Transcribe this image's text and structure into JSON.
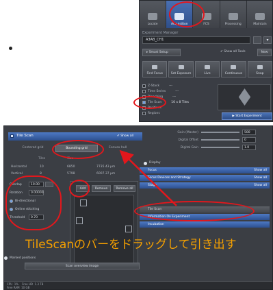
{
  "top_panel": {
    "tabs": [
      {
        "label": "Locate",
        "icon": "eye-icon"
      },
      {
        "label": "Acquisition",
        "icon": "camera-icon"
      },
      {
        "label": "FCS",
        "icon": "fcs-icon"
      },
      {
        "label": "Processing",
        "icon": "processing-icon"
      },
      {
        "label": "Maintain",
        "icon": "maintain-icon"
      }
    ],
    "experiment_label": "Experiment Manager",
    "experiment_value": "A3AB_CH1",
    "smart_setup": "Smart Setup",
    "show_all_tools": "Show all Tools",
    "new_label": "New",
    "acq_buttons": [
      "Find Focus",
      "Set Exposure",
      "Live",
      "Continuous",
      "Snap"
    ],
    "dims": [
      {
        "label": "Z-Stack",
        "checked": false,
        "value": "---"
      },
      {
        "label": "Time Series",
        "checked": false,
        "value": "---"
      },
      {
        "label": "Bleaching",
        "checked": false,
        "value": "---"
      },
      {
        "label": "Tile Scan",
        "checked": true,
        "value": "10 x 8 Tiles"
      },
      {
        "label": "Positions",
        "checked": false,
        "value": ""
      },
      {
        "label": "Regions",
        "checked": false,
        "value": ""
      }
    ],
    "start_experiment": "Start Experiment"
  },
  "bottom_panel": {
    "tile_scan_title": "Tile Scan",
    "view_all": "Show all",
    "modes": [
      "Centered grid",
      "Bounding grid",
      "Convex hull"
    ],
    "grid_headers": [
      "Tiles",
      "Size"
    ],
    "grid_rows": [
      {
        "label": "Horizontal",
        "tiles": "10",
        "size": "6850",
        "extra": "7735.43 µm"
      },
      {
        "label": "Vertical",
        "tiles": "8",
        "size": "5798",
        "extra": "6007.37 µm"
      }
    ],
    "overlap_label": "Overlap",
    "overlap_value": "10.00",
    "rotation_label": "Rotation",
    "rotation_value": "0.00000",
    "bidirectional": "Bi-directional",
    "online_stitching": "Online stitching",
    "threshold_label": "Threshold",
    "threshold_value": "0.70",
    "region_buttons": [
      "Add",
      "Remove",
      "Remove all"
    ],
    "marked_positions": "Marked positions",
    "scan_overview": "Scan overview image",
    "status": {
      "cpu": "CPU",
      "cpu_val": "1%",
      "free_hd": "Free HD",
      "free_hd_val": "1.3 TB",
      "free_ram": "Free RAM",
      "free_ram_val": "10 GB"
    },
    "right_col": {
      "gain_rows": [
        {
          "label": "Gain (Master)",
          "value": "500"
        },
        {
          "label": "Digital Offset",
          "value": "0"
        },
        {
          "label": "Digital Gain",
          "value": "1.0"
        }
      ],
      "display_label": "Display",
      "blue_bars": [
        {
          "label": "Focus",
          "right": "Show all"
        },
        {
          "label": "Focus Devices and Strategy",
          "right": "Show all"
        },
        {
          "label": "Stage",
          "right": "Show all"
        }
      ],
      "lower_bars": [
        "Tile Scan",
        "Information On Experiment",
        "Incubation"
      ]
    }
  },
  "caption": "TileScanのバーをドラッグして引き出す",
  "colors": {
    "annotation_red": "#e3171c",
    "caption_orange": "#f5a000",
    "accent_blue": "#3d63aa"
  }
}
